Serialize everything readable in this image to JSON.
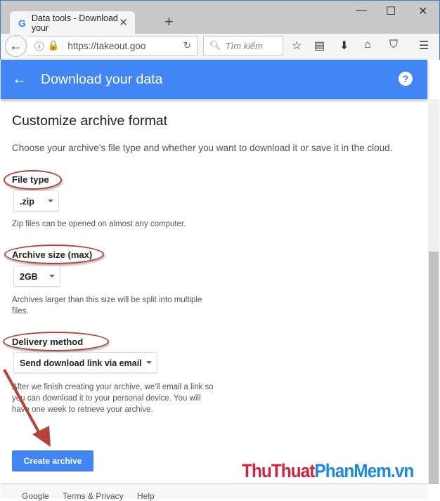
{
  "browser": {
    "tab_title": "Data tools - Download your",
    "url": "https://takeout.goo",
    "search_placeholder": "Tìm kiếm"
  },
  "header": {
    "title": "Download your data",
    "help": "?"
  },
  "main": {
    "heading": "Customize archive format",
    "description": "Choose your archive's file type and whether you want to download it or save it in the cloud.",
    "file_type": {
      "label": "File type",
      "value": ".zip",
      "help": "Zip files can be opened on almost any computer."
    },
    "archive_size": {
      "label": "Archive size (max)",
      "value": "2GB",
      "help": "Archives larger than this size will be split into multiple files."
    },
    "delivery": {
      "label": "Delivery method",
      "value": "Send download link via email",
      "help": "After we finish creating your archive, we'll email a link so you can download it to your personal device. You will have one week to retrieve your archive."
    },
    "create_button": "Create archive"
  },
  "footer": {
    "google": "Google",
    "terms": "Terms & Privacy",
    "help": "Help"
  },
  "watermark": {
    "part1": "ThuThuat",
    "part2": "PhanMem.vn",
    "color1": "#d3213f",
    "color2": "#1e88d8"
  },
  "colors": {
    "accent": "#4285f4",
    "annotation": "#b3443a"
  }
}
